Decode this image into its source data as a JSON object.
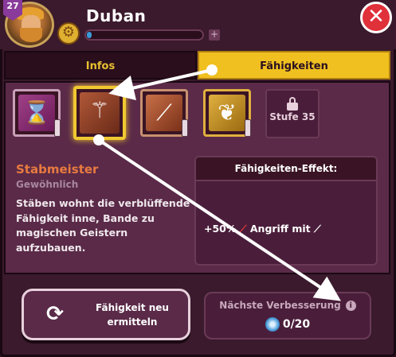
{
  "hero": {
    "level": "27",
    "name": "Duban",
    "xp_fraction": 0.04,
    "xp_plus": "+"
  },
  "close_glyph": "✕",
  "tabs": [
    {
      "label": "Infos",
      "active": false
    },
    {
      "label": "Fähigkeiten",
      "active": true
    }
  ],
  "skills": [
    {
      "icon": "hourglass-icon",
      "glyph": "⌛"
    },
    {
      "icon": "staff-icon",
      "glyph": "⚚",
      "selected": true
    },
    {
      "icon": "slash-icon",
      "glyph": "⟋"
    },
    {
      "icon": "wing-icon",
      "glyph": "❦"
    }
  ],
  "locked_skill": {
    "label": "Stufe 35"
  },
  "selected_skill": {
    "title": "Stabmeister",
    "rarity": "Gewöhnlich",
    "description": "Stäben wohnt die verblüffende Fähigkeit inne, Bande zu magischen Geistern aufzubauen."
  },
  "effect": {
    "header": "Fähigkeiten-Effekt:",
    "value": "+50%",
    "text": "Angriff mit"
  },
  "reroll": {
    "label": "Fähigkeit neu ermitteln",
    "icon": "refresh-icon"
  },
  "next_upgrade": {
    "title": "Nächste Verbesserung",
    "info": "i",
    "progress": "0/20"
  },
  "colors": {
    "accent": "#f0c020",
    "panel": "#5a2a48",
    "title": "#e87a40",
    "close": "#e0303a"
  }
}
